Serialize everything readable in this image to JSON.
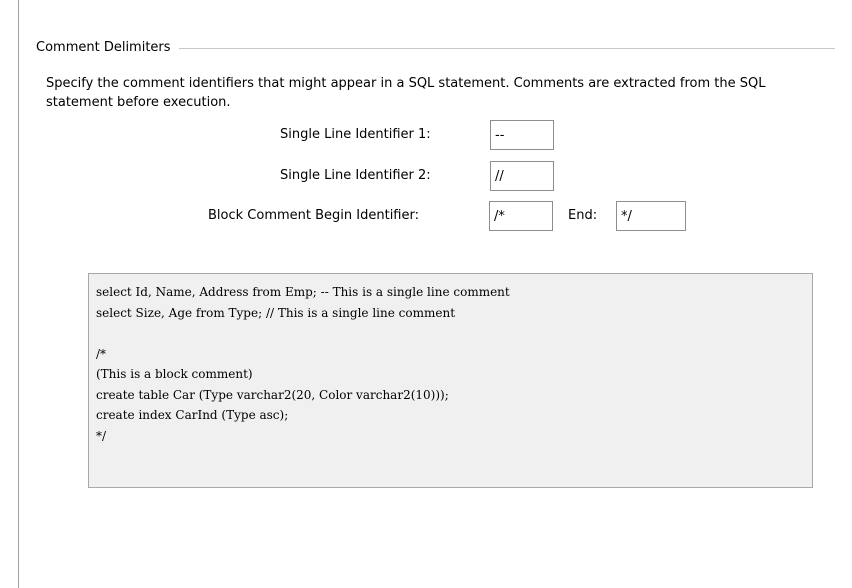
{
  "group": {
    "title": "Comment Delimiters",
    "description": "Specify the comment identifiers that might appear in a SQL statement. Comments are extracted from the SQL statement before execution."
  },
  "fields": {
    "single_line_1": {
      "label": "Single Line Identifier 1:",
      "value": "--"
    },
    "single_line_2": {
      "label": "Single Line Identifier 2:",
      "value": "//"
    },
    "block_begin": {
      "label": "Block Comment Begin Identifier:",
      "value": "/*"
    },
    "block_end": {
      "label": "End:",
      "value": "*/"
    }
  },
  "sample": {
    "lines": [
      "select Id, Name, Address from Emp; -- This is a single line comment",
      "select Size, Age from Type; // This is a single line comment",
      "",
      "/*",
      "(This is a block comment)",
      "create table Car (Type varchar2(20, Color varchar2(10)));",
      "create index CarInd (Type asc);",
      "*/"
    ]
  }
}
